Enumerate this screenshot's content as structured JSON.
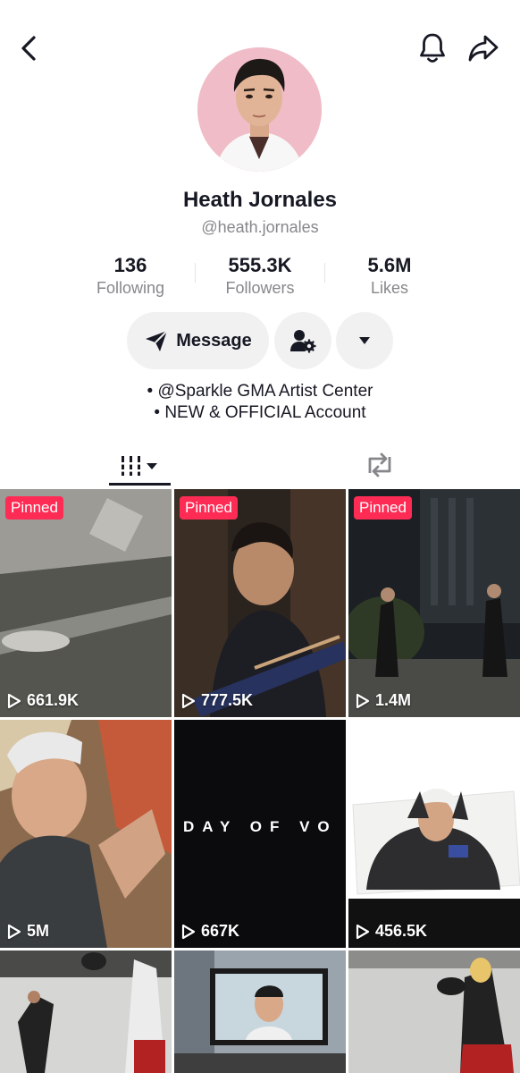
{
  "profile": {
    "name": "Heath Jornales",
    "handle": "@heath.jornales",
    "avatar_bg": "#f0bcc8"
  },
  "stats": [
    {
      "value": "136",
      "label": "Following"
    },
    {
      "value": "555.3K",
      "label": "Followers"
    },
    {
      "value": "5.6M",
      "label": "Likes"
    }
  ],
  "actions": {
    "message_label": "Message",
    "add_friend_icon": "person-gear-icon",
    "more_icon": "caret-down-icon"
  },
  "bio": [
    "• @Sparkle GMA Artist Center",
    "• NEW & OFFICIAL Account"
  ],
  "tabs": [
    {
      "icon": "grid-videos-icon",
      "selected": true
    },
    {
      "icon": "repost-icon",
      "selected": false
    }
  ],
  "videos": [
    {
      "views": "661.9K",
      "pinned": true,
      "pinned_label": "Pinned"
    },
    {
      "views": "777.5K",
      "pinned": true,
      "pinned_label": "Pinned"
    },
    {
      "views": "1.4M",
      "pinned": true,
      "pinned_label": "Pinned"
    },
    {
      "views": "5M",
      "pinned": false
    },
    {
      "views": "667K",
      "pinned": false,
      "overlay_text": "DAY OF VO"
    },
    {
      "views": "456.5K",
      "pinned": false
    },
    {
      "views": "",
      "pinned": false
    },
    {
      "views": "",
      "pinned": false
    },
    {
      "views": "",
      "pinned": false
    }
  ],
  "colors": {
    "accent_pinned": "#fe2c55",
    "text_primary": "#161823",
    "text_secondary": "#86878b",
    "button_bg": "#f1f1f2"
  }
}
